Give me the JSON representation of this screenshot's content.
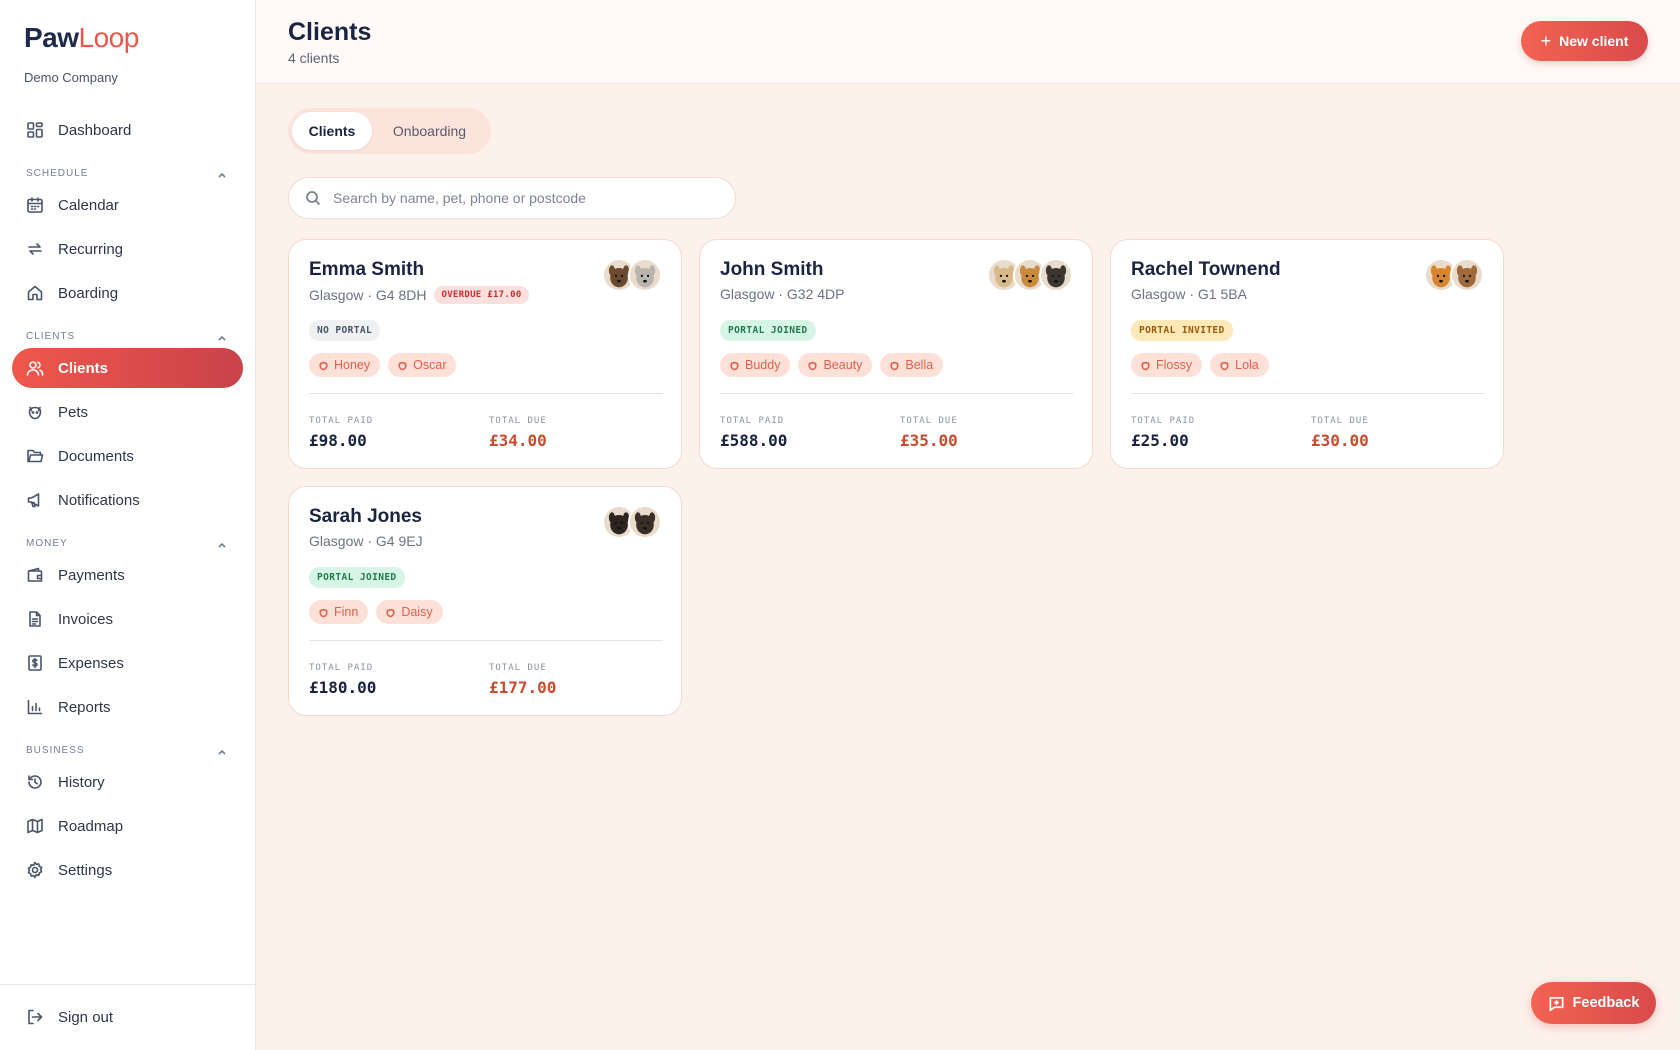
{
  "brand": {
    "name_part1": "Paw",
    "name_part2": "Loop",
    "company": "Demo Company",
    "accent": "#f0574c"
  },
  "sidebar": {
    "items": [
      {
        "label": "Dashboard",
        "icon": "dashboard-icon"
      },
      {
        "label": "Calendar",
        "icon": "calendar-icon"
      },
      {
        "label": "Recurring",
        "icon": "recurring-icon"
      },
      {
        "label": "Boarding",
        "icon": "home-icon"
      },
      {
        "label": "Clients",
        "icon": "users-icon",
        "active": true
      },
      {
        "label": "Pets",
        "icon": "paw-icon"
      },
      {
        "label": "Documents",
        "icon": "folder-icon"
      },
      {
        "label": "Notifications",
        "icon": "megaphone-icon"
      },
      {
        "label": "Payments",
        "icon": "wallet-icon"
      },
      {
        "label": "Invoices",
        "icon": "file-icon"
      },
      {
        "label": "Expenses",
        "icon": "dollar-icon"
      },
      {
        "label": "Reports",
        "icon": "bar-chart-icon"
      },
      {
        "label": "History",
        "icon": "history-icon"
      },
      {
        "label": "Roadmap",
        "icon": "map-icon"
      },
      {
        "label": "Settings",
        "icon": "gear-icon"
      }
    ],
    "sections": {
      "schedule": "SCHEDULE",
      "clients": "CLIENTS",
      "money": "MONEY",
      "business": "BUSINESS"
    },
    "sign_out": "Sign out"
  },
  "header": {
    "title": "Clients",
    "subtitle": "4 clients",
    "new_button": "New client"
  },
  "tabs": [
    {
      "label": "Clients",
      "active": true
    },
    {
      "label": "Onboarding",
      "active": false
    }
  ],
  "search": {
    "placeholder": "Search by name, pet, phone or postcode",
    "value": ""
  },
  "stat_labels": {
    "paid": "TOTAL PAID",
    "due": "TOTAL DUE"
  },
  "clients": [
    {
      "name": "Emma Smith",
      "location": "Glasgow · G4 8DH",
      "overdue": "OVERDUE £17.00",
      "portal": "NO PORTAL",
      "portal_status": "none",
      "pets": [
        "Honey",
        "Oscar"
      ],
      "paid": "£98.00",
      "due": "£34.00",
      "avatar_colors": [
        "#6b4a2e",
        "#b9b4ad"
      ]
    },
    {
      "name": "John Smith",
      "location": "Glasgow · G32 4DP",
      "overdue": "",
      "portal": "PORTAL JOINED",
      "portal_status": "joined",
      "pets": [
        "Buddy",
        "Beauty",
        "Bella"
      ],
      "paid": "£588.00",
      "due": "£35.00",
      "avatar_colors": [
        "#d7b98a",
        "#c98a3e",
        "#3b3632"
      ]
    },
    {
      "name": "Rachel Townend",
      "location": "Glasgow · G1 5BA",
      "overdue": "",
      "portal": "PORTAL INVITED",
      "portal_status": "invited",
      "pets": [
        "Flossy",
        "Lola"
      ],
      "paid": "£25.00",
      "due": "£30.00",
      "avatar_colors": [
        "#d9852f",
        "#a06a3a"
      ]
    },
    {
      "name": "Sarah Jones",
      "location": "Glasgow · G4 9EJ",
      "overdue": "",
      "portal": "PORTAL JOINED",
      "portal_status": "joined",
      "pets": [
        "Finn",
        "Daisy"
      ],
      "paid": "£180.00",
      "due": "£177.00",
      "avatar_colors": [
        "#2e2520",
        "#3a2f28"
      ]
    }
  ],
  "feedback": {
    "label": "Feedback"
  }
}
